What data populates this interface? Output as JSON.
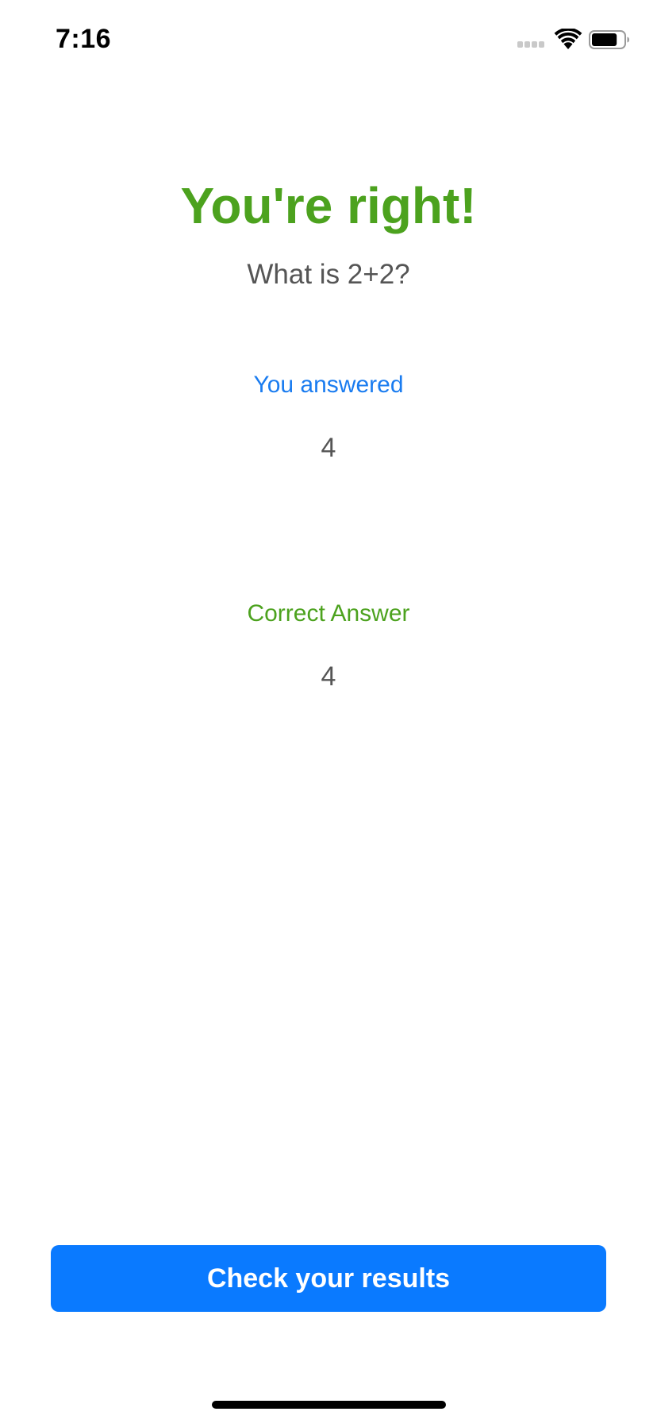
{
  "status_bar": {
    "time": "7:16",
    "signal_icon": "cellular-signal-icon",
    "wifi_icon": "wifi-icon",
    "battery_icon": "battery-icon",
    "battery_level": 0.8
  },
  "result": {
    "title": "You're right!",
    "question": "What is 2+2?",
    "you_answered_label": "You answered",
    "you_answered_value": "4",
    "correct_answer_label": "Correct Answer",
    "correct_answer_value": "4"
  },
  "actions": {
    "check_results_label": "Check your results"
  },
  "colors": {
    "success": "#4ca21e",
    "accent": "#0a7aff",
    "text_secondary": "#555555"
  }
}
